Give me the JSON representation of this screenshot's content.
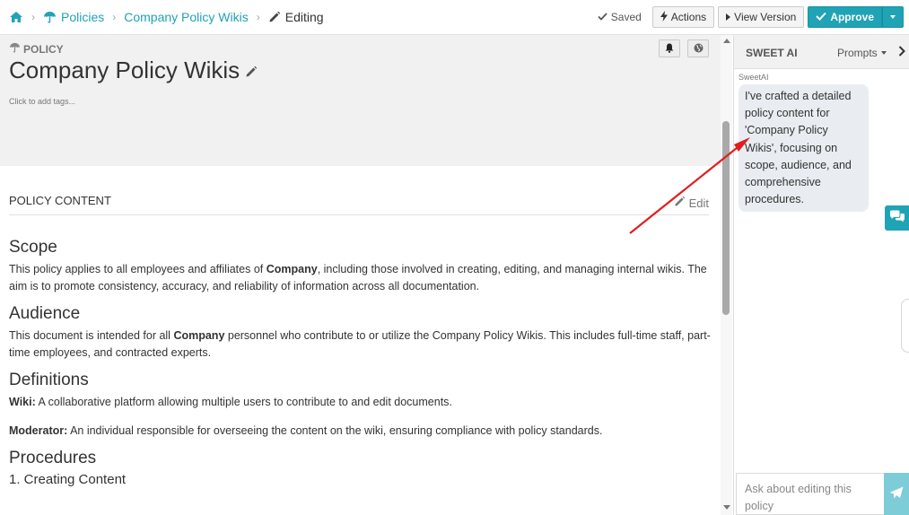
{
  "breadcrumb": {
    "items": [
      {
        "label": "Policies"
      },
      {
        "label": "Company Policy Wikis"
      },
      {
        "label": "Editing"
      }
    ]
  },
  "toolbar": {
    "saved_label": "Saved",
    "actions_label": "Actions",
    "view_version_label": "View Version",
    "approve_label": "Approve"
  },
  "header": {
    "kind_label": "POLICY",
    "title": "Company Policy Wikis",
    "tags_placeholder": "Click to add tags..."
  },
  "section": {
    "title": "POLICY CONTENT",
    "edit_label": "Edit"
  },
  "document": {
    "scope_heading": "Scope",
    "scope_text_1": "This policy applies to all employees and affiliates of ",
    "scope_bold": "Company",
    "scope_text_2": ", including those involved in creating, editing, and managing internal wikis. The aim is to promote consistency, accuracy, and reliability of information across all documentation.",
    "audience_heading": "Audience",
    "audience_text_1": "This document is intended for all ",
    "audience_bold": "Company",
    "audience_text_2": " personnel who contribute to or utilize the Company Policy Wikis. This includes full-time staff, part-time employees, and contracted experts.",
    "definitions_heading": "Definitions",
    "def_wiki_term": "Wiki:",
    "def_wiki_text": " A collaborative platform allowing multiple users to contribute to and edit documents.",
    "def_moderator_term": "Moderator:",
    "def_moderator_text": " An individual responsible for overseeing the content on the wiki, ensuring compliance with policy standards.",
    "procedures_heading": "Procedures",
    "procedure_1": "1. Creating Content"
  },
  "ai_panel": {
    "title": "SWEET AI",
    "prompts_label": "Prompts",
    "sender": "SweetAI",
    "message": "I've crafted a detailed policy content for 'Company Policy Wikis', focusing on scope, audience, and comprehensive procedures.",
    "input_placeholder": "Ask about editing this policy"
  },
  "colors": {
    "accent": "#1fa3b5",
    "annotation_arrow": "#e01e1e"
  }
}
